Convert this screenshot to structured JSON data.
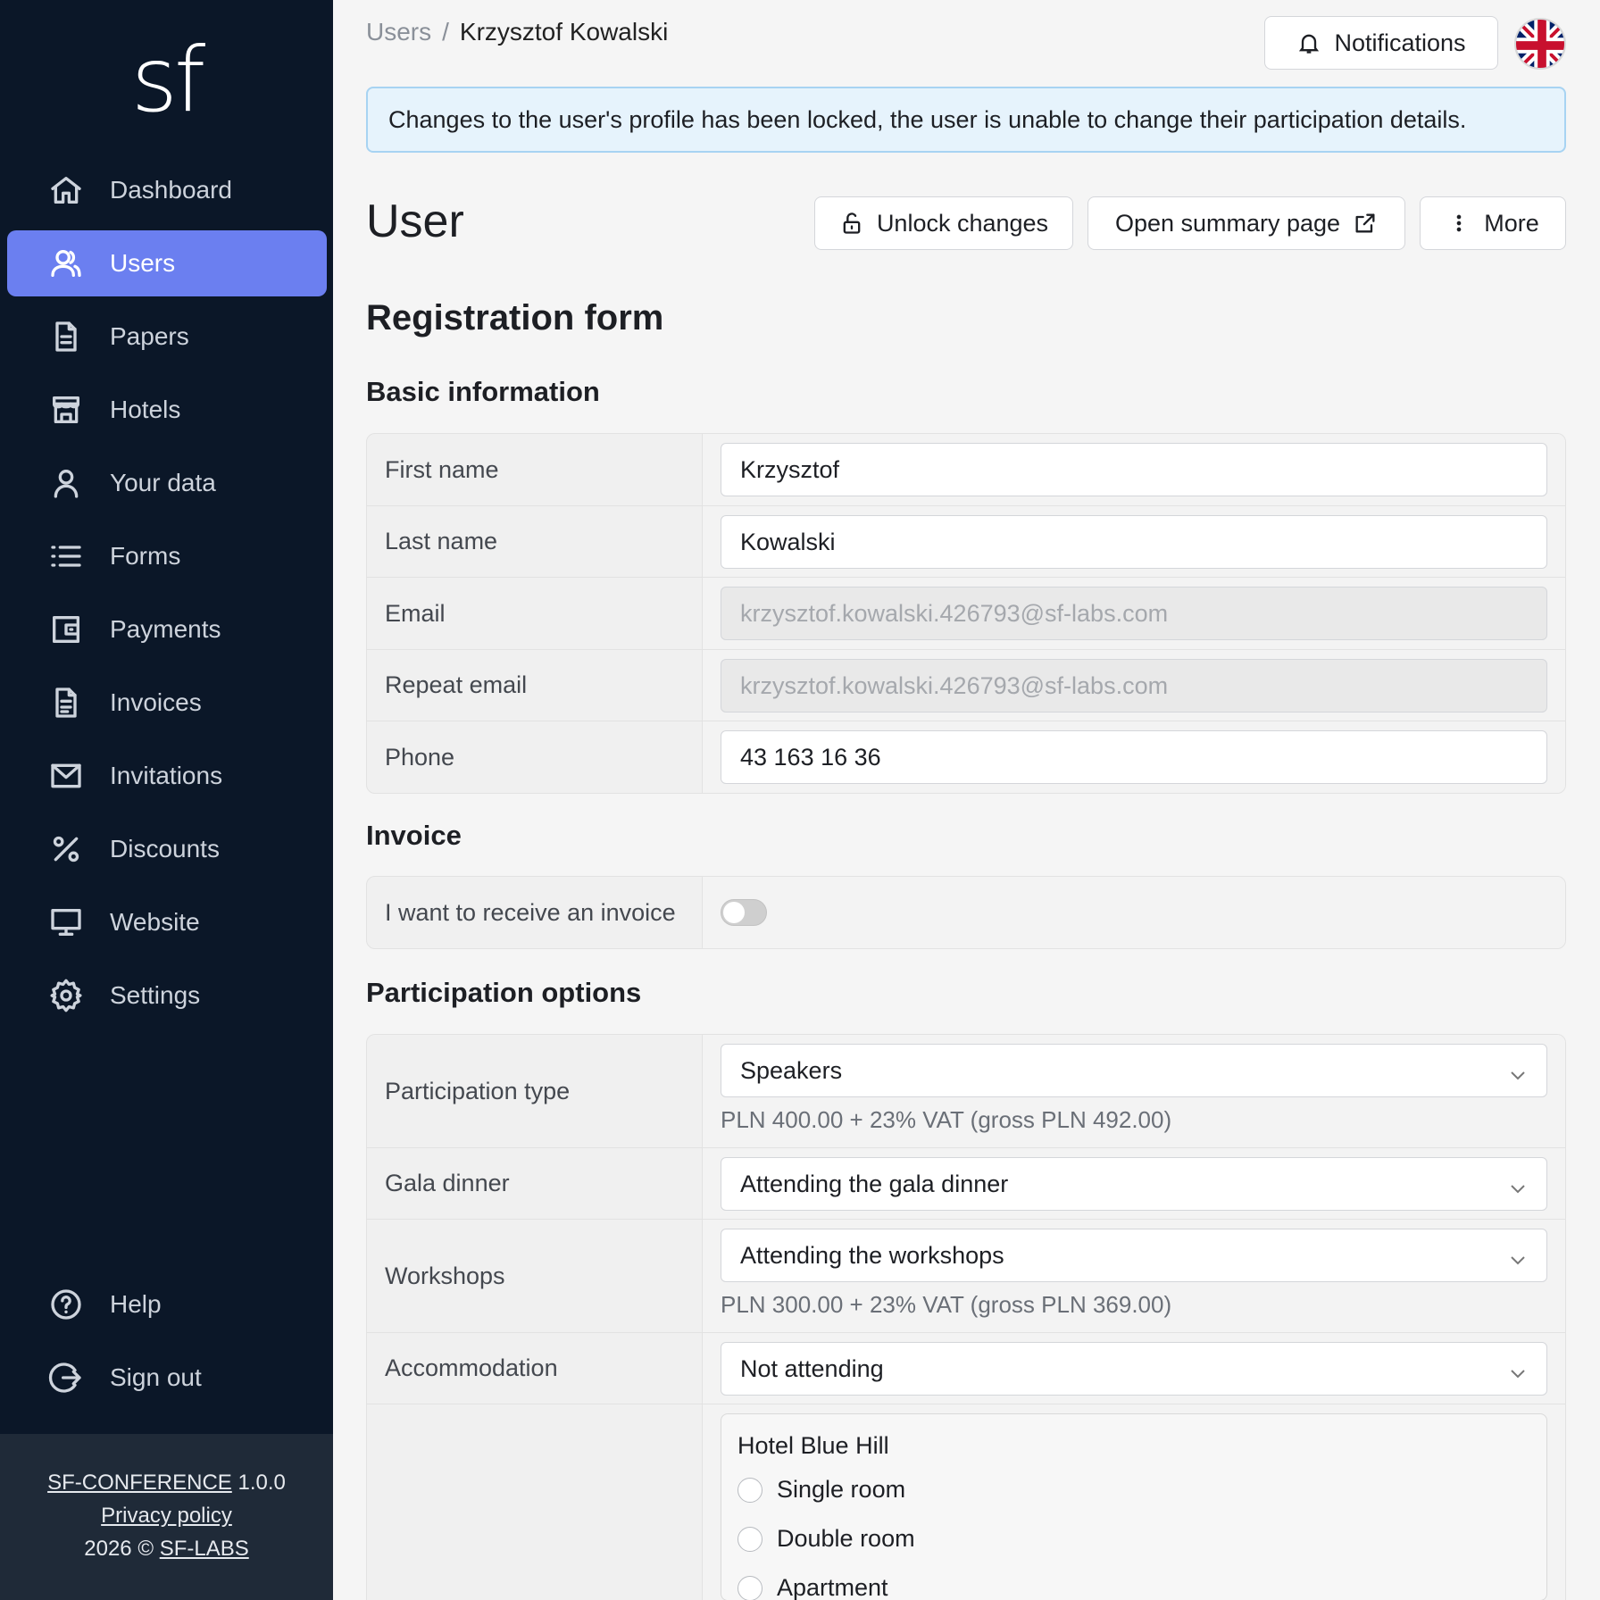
{
  "app": {
    "logo": "sf"
  },
  "sidebar": {
    "items": [
      {
        "label": "Dashboard",
        "icon": "home-icon"
      },
      {
        "label": "Users",
        "icon": "users-icon",
        "active": true
      },
      {
        "label": "Papers",
        "icon": "document-icon"
      },
      {
        "label": "Hotels",
        "icon": "hotel-icon"
      },
      {
        "label": "Your data",
        "icon": "person-icon"
      },
      {
        "label": "Forms",
        "icon": "list-icon"
      },
      {
        "label": "Payments",
        "icon": "wallet-icon"
      },
      {
        "label": "Invoices",
        "icon": "invoice-icon"
      },
      {
        "label": "Invitations",
        "icon": "mail-icon"
      },
      {
        "label": "Discounts",
        "icon": "percent-icon"
      },
      {
        "label": "Website",
        "icon": "monitor-icon"
      },
      {
        "label": "Settings",
        "icon": "gear-icon"
      }
    ],
    "bottom": [
      {
        "label": "Help",
        "icon": "help-icon"
      },
      {
        "label": "Sign out",
        "icon": "sign-out-icon"
      }
    ],
    "footer": {
      "product": "SF-CONFERENCE",
      "version": "1.0.0",
      "privacy": "Privacy policy",
      "copyright": "2026 ©",
      "company": "SF-LABS"
    }
  },
  "breadcrumb": {
    "parent": "Users",
    "separator": "/",
    "current": "Krzysztof Kowalski"
  },
  "header": {
    "notifications_label": "Notifications",
    "language": "English (UK flag)"
  },
  "alert": {
    "text": "Changes to the user's profile has been locked, the user is unable to change their participation details."
  },
  "page": {
    "title": "User",
    "actions": {
      "unlock": "Unlock changes",
      "summary": "Open summary page",
      "more": "More"
    }
  },
  "form": {
    "title": "Registration form",
    "basic": {
      "title": "Basic information",
      "first_name_label": "First name",
      "first_name": "Krzysztof",
      "last_name_label": "Last name",
      "last_name": "Kowalski",
      "email_label": "Email",
      "email": "krzysztof.kowalski.426793@sf-labs.com",
      "repeat_email_label": "Repeat email",
      "repeat_email": "krzysztof.kowalski.426793@sf-labs.com",
      "phone_label": "Phone",
      "phone": "43 163 16 36"
    },
    "invoice": {
      "title": "Invoice",
      "toggle_label": "I want to receive an invoice",
      "enabled": false
    },
    "participation": {
      "title": "Participation options",
      "type_label": "Participation type",
      "type_value": "Speakers",
      "type_price": "PLN 400.00 + 23% VAT (gross PLN 492.00)",
      "gala_label": "Gala dinner",
      "gala_value": "Attending the gala dinner",
      "workshops_label": "Workshops",
      "workshops_value": "Attending the workshops",
      "workshops_price": "PLN 300.00 + 23% VAT (gross PLN 369.00)",
      "accommodation_label": "Accommodation",
      "accommodation_value": "Not attending",
      "hotel": {
        "name": "Hotel Blue Hill",
        "options": [
          "Single room",
          "Double room",
          "Apartment"
        ]
      }
    }
  },
  "colors": {
    "sidebar_bg": "#0b1728",
    "accent": "#6b7ff0",
    "alert_bg": "#e6f3fc",
    "alert_border": "#a7d3f2"
  }
}
